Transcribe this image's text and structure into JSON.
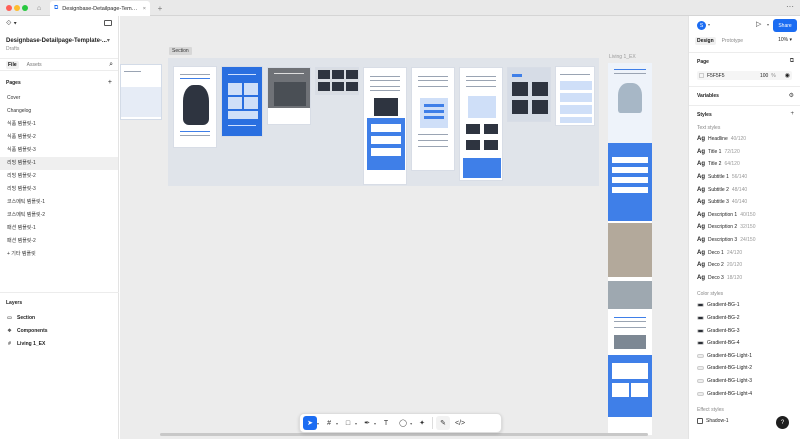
{
  "window": {
    "tab_title": "Designbase-Detailpage-Templat...",
    "more": "···"
  },
  "left_panel": {
    "file_name": "Designbase-Detailpage-Template-...",
    "file_subtitle": "Drafts",
    "tabs": [
      "File",
      "Assets"
    ],
    "pages_heading": "Pages",
    "pages": [
      {
        "label": "Cover"
      },
      {
        "label": "Changelog"
      },
      {
        "label": "식품 템플릿-1"
      },
      {
        "label": "식품 템플릿-2"
      },
      {
        "label": "식품 템플릿-3"
      },
      {
        "label": "리빙 템플릿-1"
      },
      {
        "label": "리빙 템플릿-2"
      },
      {
        "label": "리빙 템플릿-3"
      },
      {
        "label": "코스메틱 템플릿-1"
      },
      {
        "label": "코스메틱 템플릿-2"
      },
      {
        "label": "패션 템플릿-1"
      },
      {
        "label": "패션 템플릿-2"
      },
      {
        "label": "+ 기타 템플릿"
      }
    ],
    "active_page": "리빙 템플릿-1",
    "layers_heading": "Layers",
    "layers": [
      {
        "label": "Section",
        "icon": "section-icon"
      },
      {
        "label": "Components",
        "icon": "components-icon"
      },
      {
        "label": "Living 1_EX",
        "icon": "frame-icon"
      }
    ]
  },
  "canvas": {
    "section_label": "Section",
    "frame_label": "Living 1_EX"
  },
  "toolbar": {
    "tools": [
      "move",
      "frame",
      "shape",
      "pen",
      "text",
      "comment",
      "actions",
      "dev-mode"
    ]
  },
  "right_panel": {
    "avatar_initial": "S",
    "share_label": "Share",
    "tabs": [
      "Design",
      "Prototype"
    ],
    "zoom": "10%",
    "page_heading": "Page",
    "page_color": "F5F5F5",
    "page_opacity": "100",
    "variables_heading": "Variables",
    "styles_heading": "Styles",
    "text_styles_label": "Text styles",
    "text_styles": [
      {
        "name": "Headline",
        "meta": "40/120"
      },
      {
        "name": "Title 1",
        "meta": "72/120"
      },
      {
        "name": "Title 2",
        "meta": "64/120"
      },
      {
        "name": "Subtitle 1",
        "meta": "56/140"
      },
      {
        "name": "Subtitle 2",
        "meta": "48/140"
      },
      {
        "name": "Subtitle 3",
        "meta": "40/140"
      },
      {
        "name": "Description 1",
        "meta": "40/150"
      },
      {
        "name": "Description 2",
        "meta": "32/150"
      },
      {
        "name": "Description 3",
        "meta": "24/150"
      },
      {
        "name": "Deco 1",
        "meta": "24/120"
      },
      {
        "name": "Deco 2",
        "meta": "20/120"
      },
      {
        "name": "Deco 3",
        "meta": "18/120"
      }
    ],
    "color_styles_label": "Color styles",
    "color_styles": [
      {
        "name": "Gradient-BG-1",
        "color": "#2b2f36"
      },
      {
        "name": "Gradient-BG-2",
        "color": "#2b2f36"
      },
      {
        "name": "Gradient-BG-3",
        "color": "#2b2f36"
      },
      {
        "name": "Gradient-BG-4",
        "color": "#2b2f36"
      },
      {
        "name": "Gradient-BG-Light-1",
        "color": "#eeeeee"
      },
      {
        "name": "Gradient-BG-Light-2",
        "color": "#eeeeee"
      },
      {
        "name": "Gradient-BG-Light-3",
        "color": "#eeeeee"
      },
      {
        "name": "Gradient-BG-Light-4",
        "color": "#eeeeee"
      }
    ],
    "effect_styles_label": "Effect styles",
    "effect_styles": [
      {
        "name": "Shadow-1"
      }
    ]
  },
  "help": "?",
  "accent_color": "#1b6cf2"
}
